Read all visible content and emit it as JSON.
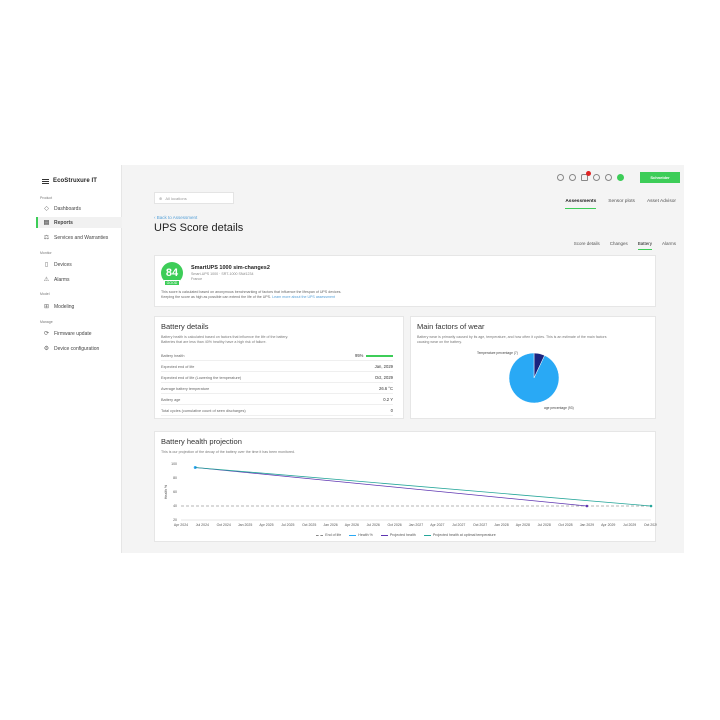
{
  "app": {
    "logo_text": "EcoStruxure IT",
    "brand_button": "Schneider"
  },
  "sidebar": {
    "sections": {
      "product": "Product",
      "monitor": "Monitor",
      "model": "Model",
      "manage": "Manage"
    },
    "items": [
      {
        "label": "Dashboards",
        "icon": "dashboard-icon"
      },
      {
        "label": "Reports",
        "icon": "report-icon",
        "active": true
      },
      {
        "label": "Services and Warranties",
        "icon": "services-icon"
      },
      {
        "label": "Devices",
        "icon": "device-icon"
      },
      {
        "label": "Alarms",
        "icon": "alarm-icon"
      },
      {
        "label": "Modeling",
        "icon": "modeling-icon"
      },
      {
        "label": "Firmware update",
        "icon": "firmware-icon"
      },
      {
        "label": "Device configuration",
        "icon": "config-icon"
      }
    ]
  },
  "header": {
    "location_placeholder": "All locations",
    "tabs": [
      "Assessments",
      "Sensor plots",
      "Asset Advisor"
    ],
    "active_tab": "Assessments",
    "back_link": "‹ Back to Assessment",
    "page_title": "UPS Score details",
    "sub_tabs": [
      "Score details",
      "Changes",
      "Battery",
      "Alarms"
    ],
    "active_sub_tab": "Battery"
  },
  "score": {
    "value": "84",
    "tag": "GOOD",
    "device_name": "SmartUPS 1000 sim-changes2",
    "device_sub": "Smart-UPS 1000 · SRT-1000 SN#1234",
    "device_location": "France",
    "desc_line1": "This score is calculated based on anonymous benchmarking of factors that influence the lifespan of UPS devices.",
    "desc_line2": "Keeping the score as high as possible can extend the life of the UPS.",
    "learn_more": "Learn more about the UPS assessment"
  },
  "battery_details": {
    "title": "Battery details",
    "desc_line1": "Battery health is calculated based on factors that influence the life of the battery.",
    "desc_line2": "Batteries that are less than 40% healthy have a high risk of failure.",
    "rows": [
      {
        "label": "Battery health",
        "value": "95%"
      },
      {
        "label": "Expected end of life",
        "value": "Jan, 2029"
      },
      {
        "label": "Expected end of life (Lowering the temperature)",
        "value": "Oct, 2029"
      },
      {
        "label": "Average battery temperature",
        "value": "26.6 °C"
      },
      {
        "label": "Battery age",
        "value": "0.2 Y"
      },
      {
        "label": "Total cycles (cumulative count of seen discharges)",
        "value": "0"
      }
    ],
    "health_fraction": 0.95
  },
  "wear": {
    "title": "Main factors of wear",
    "desc_line1": "Battery wear is primarily caused by its age, temperature, and how often it cycles. This is an estimate of the main factors",
    "desc_line2": "causing wear on the battery.",
    "slices": [
      {
        "label": "Temperature percentage (7)",
        "value": 7,
        "color": "#1a237e"
      },
      {
        "label": "age percentage (93)",
        "value": 93,
        "color": "#29a9f5"
      }
    ]
  },
  "projection": {
    "title": "Battery health projection",
    "desc": "This is our projection of the decay of the battery over the time it has been monitored."
  },
  "chart_data": {
    "type": "line",
    "ylabel": "Health %",
    "yticks": [
      "100",
      "80",
      "60",
      "40",
      "20"
    ],
    "ylim": [
      20,
      100
    ],
    "x": [
      "Apr 2024",
      "Jul 2024",
      "Oct 2024",
      "Jan 2025",
      "Apr 2025",
      "Jul 2025",
      "Oct 2025",
      "Jan 2026",
      "Apr 2026",
      "Jul 2026",
      "Oct 2026",
      "Jan 2027",
      "Apr 2027",
      "Jul 2027",
      "Oct 2027",
      "Jan 2028",
      "Apr 2028",
      "Jul 2028",
      "Oct 2028",
      "Jan 2029",
      "Apr 2029",
      "Jul 2029",
      "Oct 2029"
    ],
    "series": [
      {
        "name": "End of life",
        "points": [
          [
            "Apr 2024",
            40
          ],
          [
            "Oct 2029",
            40
          ]
        ],
        "color": "#9e9e9e",
        "dashed": true
      },
      {
        "name": "Health %",
        "points": [
          [
            "Jun 2024",
            95
          ]
        ],
        "color": "#29a9f5"
      },
      {
        "name": "Projected health",
        "points": [
          [
            "Jun 2024",
            95
          ],
          [
            "Jan 2029",
            40
          ]
        ],
        "color": "#5e35b1"
      },
      {
        "name": "Projected health at optimal temperature",
        "points": [
          [
            "Jun 2024",
            95
          ],
          [
            "Oct 2029",
            40
          ]
        ],
        "color": "#26a69a"
      }
    ]
  }
}
